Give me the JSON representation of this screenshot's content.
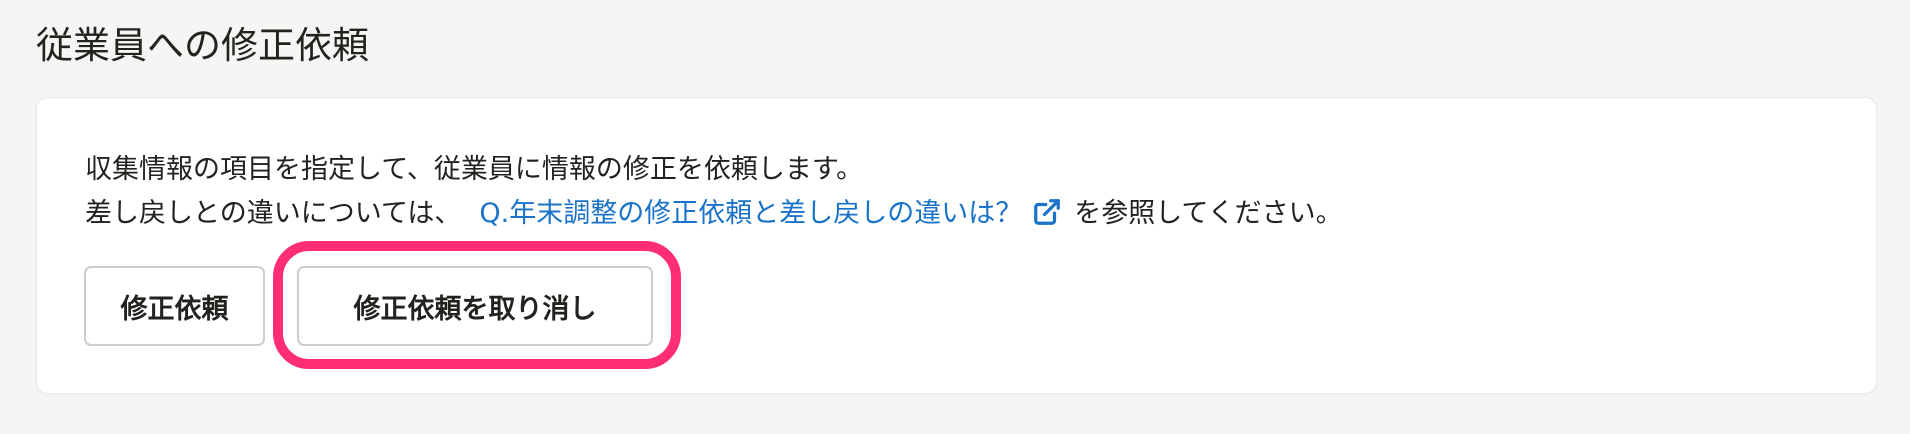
{
  "page": {
    "section_title": "従業員への修正依頼"
  },
  "description": {
    "line1": "収集情報の項目を指定して、従業員に情報の修正を依頼します。",
    "line2_prefix": "差し戻しとの違いについては、",
    "link_text": "Q.年末調整の修正依頼と差し戻しの違いは？",
    "link_icon": "external-link-icon",
    "line2_suffix": "を参照してください。"
  },
  "buttons": {
    "request_label": "修正依頼",
    "cancel_label": "修正依頼を取り消し"
  },
  "colors": {
    "link": "#1a73c9",
    "highlight": "#ff2d72",
    "background": "#f6f5f4"
  }
}
